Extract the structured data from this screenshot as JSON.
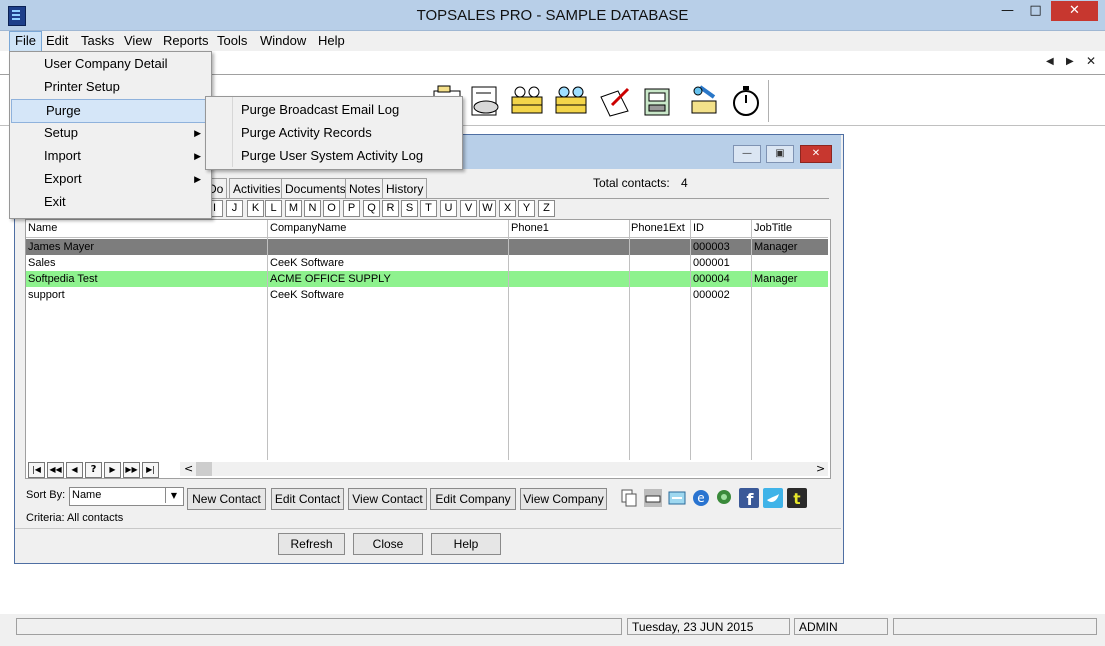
{
  "window": {
    "title": "TOPSALES PRO - SAMPLE DATABASE"
  },
  "menubar": [
    "File",
    "Edit",
    "Tasks",
    "View",
    "Reports",
    "Tools",
    "Window",
    "Help"
  ],
  "file_menu": [
    {
      "label": "User Company Detail",
      "submenu": false
    },
    {
      "label": "Printer Setup",
      "submenu": false
    },
    {
      "label": "Purge",
      "submenu": true
    },
    {
      "label": "Setup",
      "submenu": true
    },
    {
      "label": "Import",
      "submenu": true
    },
    {
      "label": "Export",
      "submenu": true
    },
    {
      "label": "Exit",
      "submenu": false
    }
  ],
  "purge_menu": [
    "Purge Broadcast Email Log",
    "Purge Activity Records",
    "Purge User System Activity Log"
  ],
  "tabs": [
    "Do",
    "Activities",
    "Documents",
    "Notes",
    "History"
  ],
  "total": {
    "label": "Total contacts:",
    "value": "4"
  },
  "letters": [
    "I",
    "J",
    "K",
    "L",
    "M",
    "N",
    "O",
    "P",
    "Q",
    "R",
    "S",
    "T",
    "U",
    "V",
    "W",
    "X",
    "Y",
    "Z"
  ],
  "grid": {
    "columns": [
      "Name",
      "CompanyName",
      "Phone1",
      "Phone1Ext",
      "ID",
      "JobTitle"
    ],
    "rows": [
      {
        "name": "James Mayer",
        "company": "",
        "phone": "",
        "ext": "",
        "id": "000003",
        "job": "Manager",
        "style": "selected"
      },
      {
        "name": "Sales",
        "company": "CeeK Software",
        "phone": "",
        "ext": "",
        "id": "000001",
        "job": "",
        "style": "normal"
      },
      {
        "name": "Softpedia Test",
        "company": "ACME OFFICE SUPPLY",
        "phone": "",
        "ext": "",
        "id": "000004",
        "job": "Manager",
        "style": "green"
      },
      {
        "name": "support",
        "company": "CeeK Software",
        "phone": "",
        "ext": "",
        "id": "000002",
        "job": "",
        "style": "normal"
      }
    ]
  },
  "sort": {
    "label": "Sort By:",
    "value": "Name"
  },
  "criteria": "Criteria: All contacts",
  "buttons": {
    "new_contact": "New Contact",
    "edit_contact": "Edit Contact",
    "view_contact": "View Contact",
    "edit_company": "Edit Company",
    "view_company": "View Company",
    "refresh": "Refresh",
    "close": "Close",
    "help": "Help"
  },
  "status": {
    "date": "Tuesday, 23 JUN 2015",
    "user": "ADMIN"
  },
  "colors": {
    "selected_row": "#7d7d7d",
    "green_row": "#8ef28e",
    "titlebar": "#b8cfe8"
  }
}
